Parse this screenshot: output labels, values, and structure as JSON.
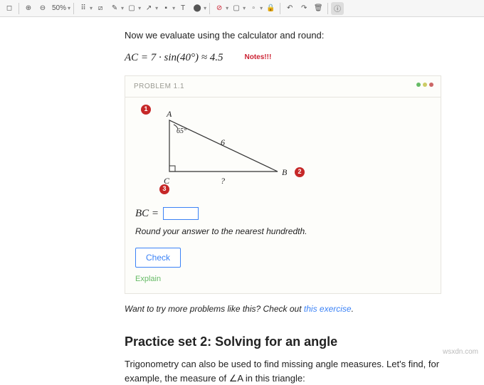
{
  "toolbar": {
    "zoom": "50%"
  },
  "content": {
    "intro": "Now we evaluate using the calculator and round:",
    "equation": "AC = 7 · sin(40°) ≈ 4.5",
    "notes_label": "Notes!!!"
  },
  "problem": {
    "header": "PROBLEM 1.1",
    "badges": {
      "b1": "1",
      "b2": "2",
      "b3": "3"
    },
    "triangle": {
      "A": "A",
      "B": "B",
      "C": "C",
      "angle": "65°",
      "hyp": "6",
      "base": "?"
    },
    "answer_label": "BC =",
    "answer_value": "",
    "hint": "Round your answer to the nearest hundredth.",
    "check": "Check",
    "explain": "Explain"
  },
  "more": {
    "prefix": "Want to try more problems like this? Check out ",
    "link": "this exercise",
    "suffix": "."
  },
  "section2": {
    "title": "Practice set 2: Solving for an angle",
    "body": "Trigonometry can also be used to find missing angle measures. Let's find, for example, the measure of ∠A in this triangle:"
  },
  "watermark": "wsxdn.com"
}
